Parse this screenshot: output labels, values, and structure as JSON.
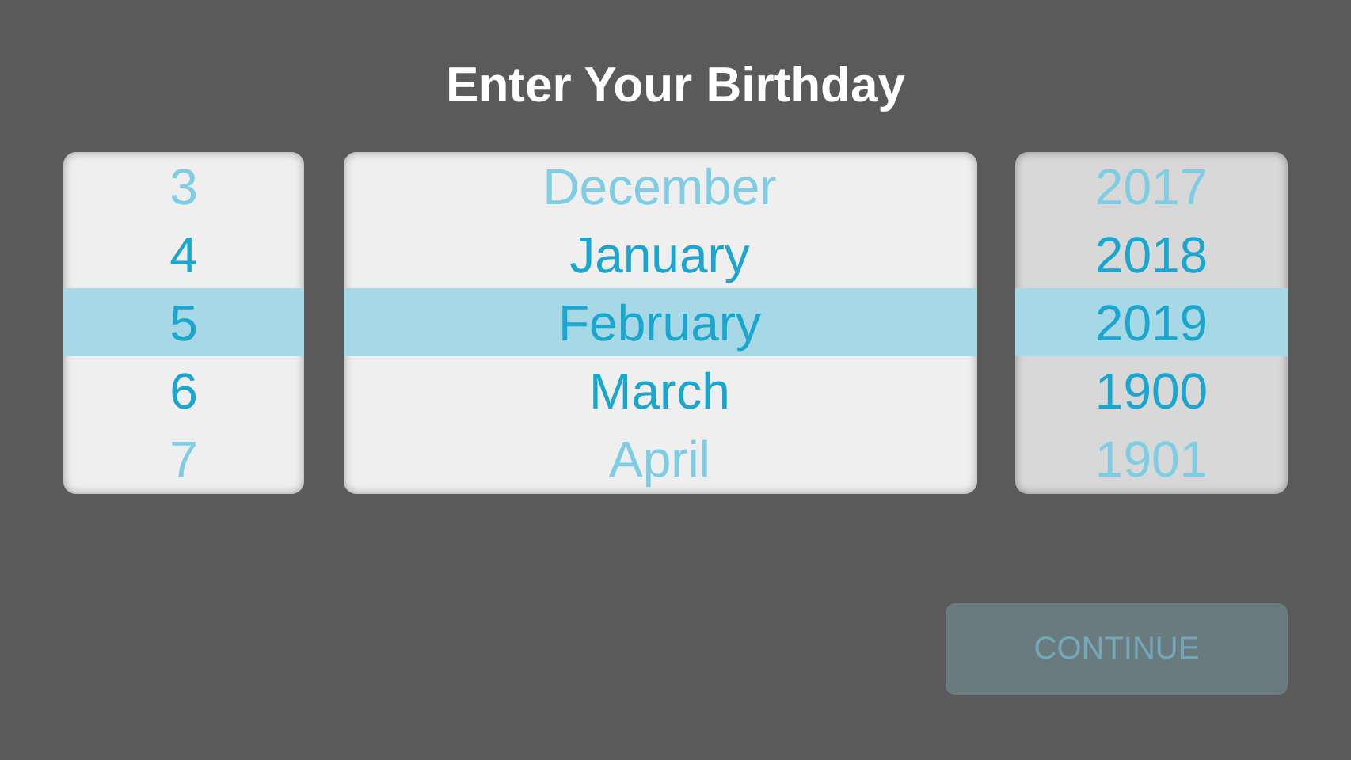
{
  "title": "Enter Your Birthday",
  "wheels": [
    {
      "color": "#efefef",
      "items": [
        {
          "label": "3",
          "selected": false
        },
        {
          "label": "4",
          "selected": false
        },
        {
          "label": "5",
          "selected": true
        },
        {
          "label": "6",
          "selected": false
        },
        {
          "label": "7",
          "selected": false
        }
      ]
    },
    {
      "color": "#efefef",
      "items": [
        {
          "label": "December",
          "selected": false
        },
        {
          "label": "January",
          "selected": false
        },
        {
          "label": "February",
          "selected": true
        },
        {
          "label": "March",
          "selected": false
        },
        {
          "label": "April",
          "selected": false
        }
      ]
    },
    {
      "color": "#d8d8d8",
      "items": [
        {
          "label": "2017",
          "selected": false
        },
        {
          "label": "2018",
          "selected": false
        },
        {
          "label": "2019",
          "selected": true
        },
        {
          "label": "1900",
          "selected": false
        },
        {
          "label": "1901",
          "selected": false
        }
      ]
    }
  ],
  "continue_button": {
    "label": "CONTINUE",
    "disabled": true
  }
}
